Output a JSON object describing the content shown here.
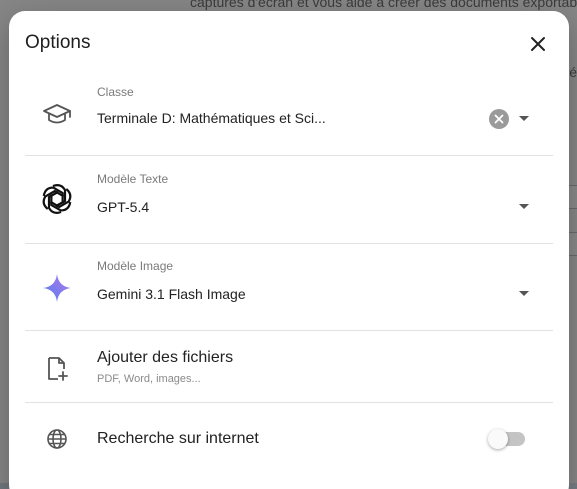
{
  "background": {
    "snippet_top": "captures d'écran et vous aide à créer des documents exportables",
    "snippet_right": "é"
  },
  "dialog": {
    "title": "Options",
    "close_icon": "close-icon"
  },
  "fields": {
    "classe": {
      "label": "Classe",
      "value": "Terminale D: Mathématiques et Sci...",
      "icon": "graduation-cap-icon"
    },
    "modele_texte": {
      "label": "Modèle Texte",
      "value": "GPT-5.4",
      "icon": "openai-logo-icon"
    },
    "modele_image": {
      "label": "Modèle Image",
      "value": "Gemini 3.1 Flash Image",
      "icon": "gemini-sparkle-icon"
    }
  },
  "actions": {
    "files": {
      "title": "Ajouter des fichiers",
      "subtitle": "PDF, Word, images...",
      "icon": "file-add-icon"
    },
    "web_search": {
      "title": "Recherche sur internet",
      "icon": "globe-icon",
      "enabled": false
    }
  },
  "colors": {
    "gemini_gradient_start": "#4f7df3",
    "gemini_gradient_end": "#b879e6",
    "toggle_off": "#c4c4c4"
  }
}
